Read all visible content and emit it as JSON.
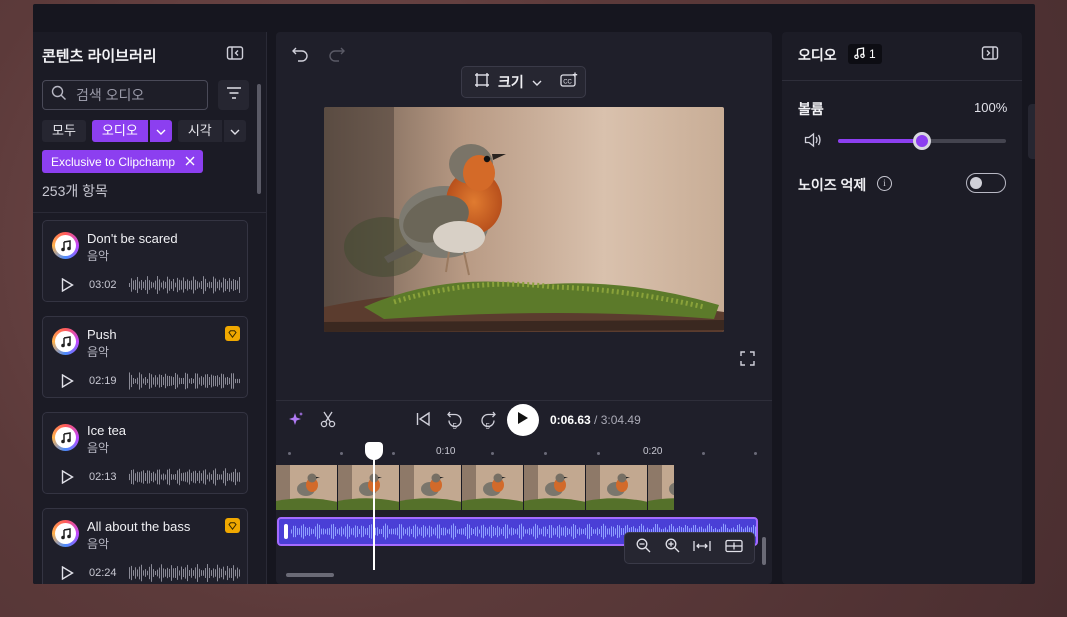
{
  "library": {
    "title": "콘텐츠 라이브러리",
    "search_placeholder": "검색 오디오",
    "chips": {
      "all": "모두",
      "audio": "오디오",
      "visual": "시각"
    },
    "tag": "Exclusive to Clipchamp",
    "count": "253개 항목",
    "tracks": [
      {
        "name": "Don't be scared",
        "genre": "음악",
        "duration": "03:02",
        "premium": false
      },
      {
        "name": "Push",
        "genre": "음악",
        "duration": "02:19",
        "premium": true
      },
      {
        "name": "Ice tea",
        "genre": "음악",
        "duration": "02:13",
        "premium": false
      },
      {
        "name": "All about the bass",
        "genre": "음악",
        "duration": "02:24",
        "premium": true
      }
    ]
  },
  "editor": {
    "resize_label": "크기",
    "time_current": "0:06.63",
    "time_total": "/ 3:04.49",
    "ruler": {
      "mark1": "0:10",
      "mark2": "0:20"
    },
    "playhead_position_seconds": 6.63
  },
  "properties": {
    "title": "오디오",
    "badge_count": "1",
    "volume_label": "볼륨",
    "volume_value": "100%",
    "volume_level": 0.5,
    "noise_label": "노이즈 억제",
    "noise_enabled": false
  },
  "colors": {
    "accent": "#8c3ff0",
    "panel": "#1b1b25",
    "premium": "#f0a800"
  }
}
